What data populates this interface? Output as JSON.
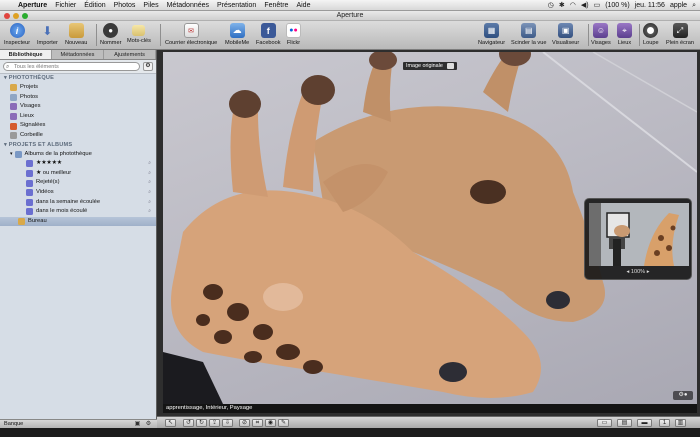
{
  "menubar": {
    "items": [
      "Aperture",
      "Fichier",
      "Édition",
      "Photos",
      "Piles",
      "Métadonnées",
      "Présentation",
      "Fenêtre",
      "Aide"
    ],
    "battery": "(100 %)",
    "clock": "jeu. 11:56",
    "user": "apple"
  },
  "window": {
    "title": "Aperture"
  },
  "toolbar": {
    "inspecteur": "Inspecteur",
    "importer": "Importer",
    "nouveau": "Nouveau",
    "nommer": "Nommer",
    "mots_cles": "Mots-clés",
    "courrier": "Courrier électronique",
    "mobileme": "MobileMe",
    "facebook": "Facebook",
    "flickr": "Flickr",
    "navigateur": "Navigateur",
    "scinder": "Scinder la vue",
    "visualiseur": "Visualiseur",
    "visages": "Visages",
    "lieux": "Lieux",
    "loupe": "Loupe",
    "plein_ecran": "Plein écran"
  },
  "sidebar": {
    "tabs": [
      "Bibliothèque",
      "Métadonnées",
      "Ajustements"
    ],
    "search_placeholder": "Tous les éléments",
    "library_header": "PHOTOTHÈQUE",
    "library_items": [
      "Projets",
      "Photos",
      "Visages",
      "Lieux",
      "Signalées",
      "Corbeille"
    ],
    "projects_header": "PROJETS ET ALBUMS",
    "albums_folder": "Albums de la photothèque",
    "albums": [
      "★★★★★",
      "★ ou meilleur",
      "Rejeté(s)",
      "Vidéos",
      "dans la semaine écoulée",
      "dans le mois écoulé"
    ],
    "selected_item": "Bureau",
    "footer_label": "Banque"
  },
  "viewer": {
    "badge": "Image originale",
    "metadata": "apprentissage, Intérieur, Paysage"
  },
  "navigator": {
    "zoom": "100%"
  },
  "colors": {
    "accent_blue": "#3d7ed8",
    "facebook_blue": "#3b5998",
    "selection": "#a8b8cf"
  }
}
